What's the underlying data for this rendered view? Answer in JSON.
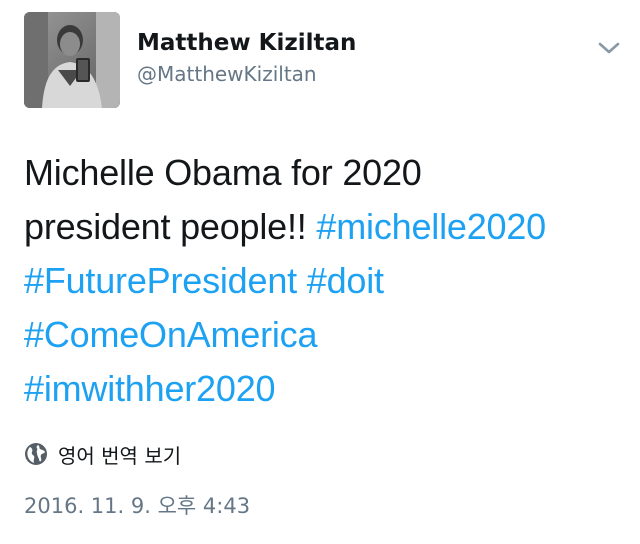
{
  "user": {
    "display_name": "Matthew Kiziltan",
    "handle": "@MatthewKiziltan"
  },
  "tweet": {
    "lines": [
      [
        {
          "text": "Michelle Obama for 2020",
          "hashtag": false
        }
      ],
      [
        {
          "text": "president people!! ",
          "hashtag": false
        },
        {
          "text": "#michelle2020",
          "hashtag": true
        }
      ],
      [
        {
          "text": "#FuturePresident",
          "hashtag": true
        },
        {
          "text": " ",
          "hashtag": false
        },
        {
          "text": "#doit",
          "hashtag": true
        }
      ],
      [
        {
          "text": "#ComeOnAmerica",
          "hashtag": true
        }
      ],
      [
        {
          "text": "#imwithher2020",
          "hashtag": true
        }
      ]
    ]
  },
  "translate": {
    "label": "영어 번역 보기",
    "icon": "globe-icon"
  },
  "timestamp": "2016. 11. 9. 오후 4:43",
  "menu_icon": "chevron-down-icon",
  "colors": {
    "hashtag": "#1da1f2",
    "secondary_text": "#657786",
    "primary_text": "#14171a"
  }
}
